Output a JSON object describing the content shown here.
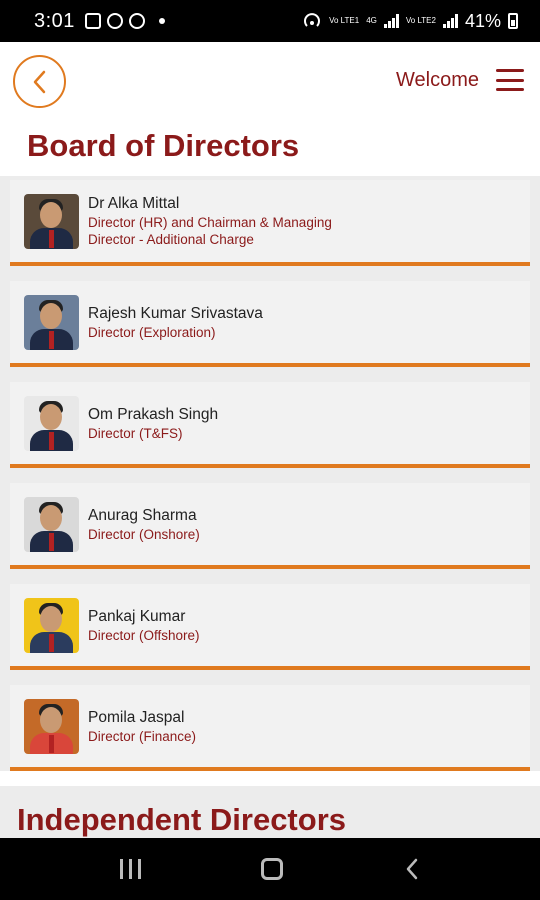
{
  "status_bar": {
    "time": "3:01",
    "dot": "•",
    "net1": "Vo LTE1",
    "net2": "4G",
    "net3": "Vo LTE2",
    "battery": "41%"
  },
  "header": {
    "back_icon": "chevron-left-icon",
    "welcome": "Welcome",
    "menu_icon": "hamburger-icon"
  },
  "board": {
    "title": "Board of Directors",
    "directors": [
      {
        "name": "Dr Alka Mittal",
        "designation": "Director (HR) and Chairman & Managing Director - Additional Charge",
        "photo_bg": "#5a4a3a",
        "shirt": "#1f2a44"
      },
      {
        "name": "Rajesh Kumar Srivastava",
        "designation": "Director (Exploration)",
        "photo_bg": "#6b7f9a",
        "shirt": "#1f2a44"
      },
      {
        "name": "Om Prakash Singh",
        "designation": "Director (T&FS)",
        "photo_bg": "#e8e8e8",
        "shirt": "#1f2a44"
      },
      {
        "name": "Anurag Sharma",
        "designation": "Director (Onshore)",
        "photo_bg": "#d9d9d9",
        "shirt": "#1f2a44"
      },
      {
        "name": "Pankaj Kumar",
        "designation": "Director (Offshore)",
        "photo_bg": "#f0c419",
        "shirt": "#2b3c5e"
      },
      {
        "name": "Pomila Jaspal",
        "designation": "Director (Finance)",
        "photo_bg": "#c46a28",
        "shirt": "#d9463a"
      }
    ]
  },
  "independent": {
    "title": "Independent Directors"
  },
  "nav": {
    "recents": "recents-icon",
    "home": "home-icon",
    "back": "back-icon"
  },
  "colors": {
    "accent": "#e07a1f",
    "brand": "#8b1a1a"
  }
}
